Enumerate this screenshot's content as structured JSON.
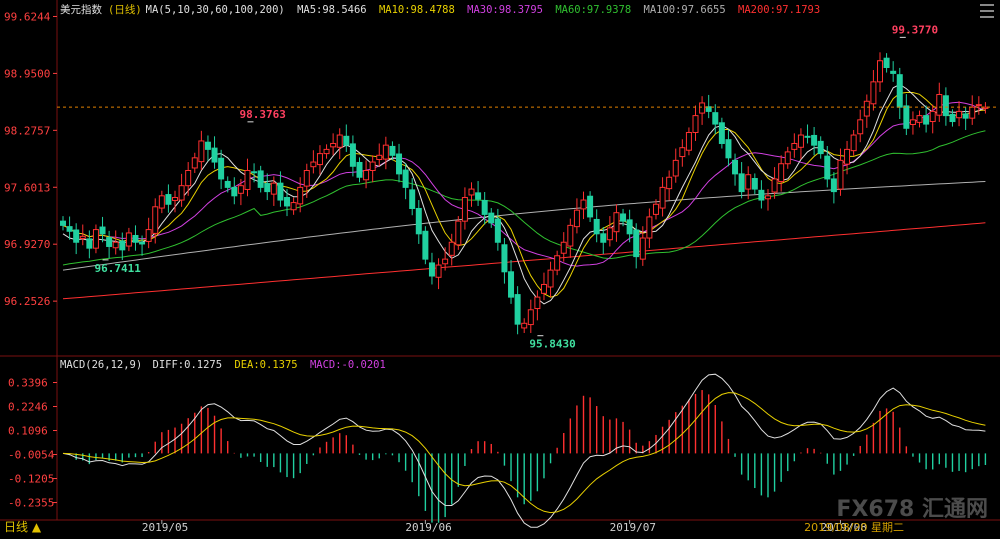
{
  "legend_main": {
    "name": "美元指数",
    "period": "(日线)",
    "ma_def": "MA(5,10,30,60,100,200)",
    "items": [
      {
        "label": "MA5:98.5466",
        "color": "#e0e0e0"
      },
      {
        "label": "MA10:98.4788",
        "color": "#e8d000"
      },
      {
        "label": "MA30:98.3795",
        "color": "#d040e0"
      },
      {
        "label": "MA60:97.9378",
        "color": "#30c030"
      },
      {
        "label": "MA100:97.6655",
        "color": "#b0b0b0"
      },
      {
        "label": "MA200:97.1793",
        "color": "#ff3030"
      }
    ]
  },
  "legend_macd": {
    "name": "MACD(26,12,9)",
    "items": [
      {
        "label": "DIFF:0.1275",
        "color": "#e0e0e0"
      },
      {
        "label": "DEA:0.1375",
        "color": "#e8d000"
      },
      {
        "label": "MACD:-0.0201",
        "color": "#d040e0"
      }
    ]
  },
  "bottom_bar": {
    "period_label": "日线 ▲",
    "date_label": "2019/08/20 星期二",
    "logo": "FX678 汇通网"
  },
  "chart_data": [
    {
      "type": "candlestick",
      "title": "美元指数 (日线)",
      "y_ticks": [
        99.6244,
        98.95,
        98.2757,
        97.6013,
        96.927,
        96.2526
      ],
      "ylim": [
        95.65,
        99.63
      ],
      "x_ticks": [
        "2019/05",
        "2019/06",
        "2019/07",
        "2019/08"
      ],
      "current_price": 98.55,
      "annotations": [
        {
          "label": "98.3763",
          "value": 98.3763,
          "kind": "high"
        },
        {
          "label": "99.3770",
          "value": 99.377,
          "kind": "high"
        },
        {
          "label": "96.7411",
          "value": 96.7411,
          "kind": "low"
        },
        {
          "label": "95.8430",
          "value": 95.843,
          "kind": "low"
        }
      ],
      "close": [
        97.15,
        97.08,
        96.95,
        97.02,
        96.88,
        97.1,
        97.05,
        96.9,
        96.95,
        96.86,
        97.06,
        96.95,
        96.93,
        97.1,
        97.37,
        97.5,
        97.4,
        97.48,
        97.62,
        97.8,
        97.95,
        98.15,
        98.05,
        97.9,
        97.7,
        97.6,
        97.5,
        97.62,
        97.8,
        97.78,
        97.6,
        97.55,
        97.65,
        97.45,
        97.38,
        97.42,
        97.6,
        97.8,
        97.9,
        98.0,
        98.05,
        98.12,
        98.22,
        98.1,
        97.85,
        97.72,
        97.8,
        97.9,
        97.98,
        98.1,
        97.98,
        97.76,
        97.6,
        97.35,
        97.05,
        96.75,
        96.55,
        96.68,
        96.75,
        96.95,
        97.2,
        97.48,
        97.58,
        97.46,
        97.28,
        97.18,
        96.95,
        96.6,
        96.3,
        95.98,
        95.99,
        96.15,
        96.3,
        96.45,
        96.62,
        96.79,
        96.95,
        97.15,
        97.33,
        97.45,
        97.25,
        97.05,
        96.95,
        97.12,
        97.3,
        97.2,
        97.05,
        96.78,
        97.0,
        97.25,
        97.4,
        97.6,
        97.72,
        97.92,
        98.07,
        98.25,
        98.45,
        98.6,
        98.5,
        98.35,
        98.12,
        97.95,
        97.76,
        97.55,
        97.75,
        97.58,
        97.45,
        97.5,
        97.7,
        97.88,
        98.02,
        98.12,
        98.22,
        98.2,
        98.1,
        98.0,
        97.7,
        97.55,
        97.92,
        98.05,
        98.22,
        98.4,
        98.62,
        98.85,
        99.1,
        99.02,
        98.95,
        98.55,
        98.3,
        98.4,
        98.45,
        98.35,
        98.5,
        98.7,
        98.45,
        98.38,
        98.5,
        98.42,
        98.55,
        98.58,
        98.55
      ],
      "ma": {
        "MA5": [
          97.05,
          97.0,
          96.98,
          96.99,
          96.97,
          96.99,
          96.98,
          96.97,
          96.96,
          96.94,
          96.96,
          96.96,
          96.95,
          96.99,
          97.06,
          97.17,
          97.27,
          97.37,
          97.47,
          97.56,
          97.65,
          97.8,
          97.91,
          97.99,
          98.0,
          97.95,
          97.86,
          97.78,
          97.73,
          97.69,
          97.66,
          97.67,
          97.68,
          97.61,
          97.53,
          97.49,
          97.49,
          97.53,
          97.62,
          97.74,
          97.87,
          97.97,
          98.06,
          98.1,
          98.07,
          98.01,
          97.94,
          97.87,
          97.85,
          97.9,
          97.95,
          97.94,
          97.88,
          97.76,
          97.55,
          97.31,
          97.09,
          96.96,
          96.84,
          96.76,
          96.8,
          96.92,
          97.08,
          97.17,
          97.24,
          97.27,
          97.24,
          97.12,
          96.95,
          96.74,
          96.52,
          96.38,
          96.28,
          96.22,
          96.26,
          96.36,
          96.5,
          96.65,
          96.82,
          96.99,
          97.07,
          97.09,
          97.09,
          97.11,
          97.17,
          97.17,
          97.15,
          97.1,
          97.07,
          97.07,
          97.08,
          97.15,
          97.28,
          97.44,
          97.6,
          97.75,
          97.9,
          98.07,
          98.22,
          98.31,
          98.33,
          98.29,
          98.2,
          98.07,
          98.0,
          97.9,
          97.8,
          97.74,
          97.7,
          97.68,
          97.7,
          97.8,
          97.93,
          98.02,
          98.07,
          98.07,
          98.02,
          97.95,
          97.91,
          97.89,
          97.9,
          97.97,
          98.1,
          98.27,
          98.48,
          98.63,
          98.78,
          98.82,
          98.77,
          98.7,
          98.62,
          98.55,
          98.49,
          98.48,
          98.5,
          98.49,
          98.49,
          98.5,
          98.49,
          98.51,
          98.55
        ]
      },
      "macd": {
        "y_ticks": [
          0.3396,
          0.2246,
          0.1096,
          -0.0054,
          -0.1205,
          -0.2355
        ],
        "ylim": [
          -0.3,
          0.39
        ],
        "diff_last": 0.1275,
        "dea_last": 0.1375,
        "macd_last": -0.0201
      }
    }
  ]
}
